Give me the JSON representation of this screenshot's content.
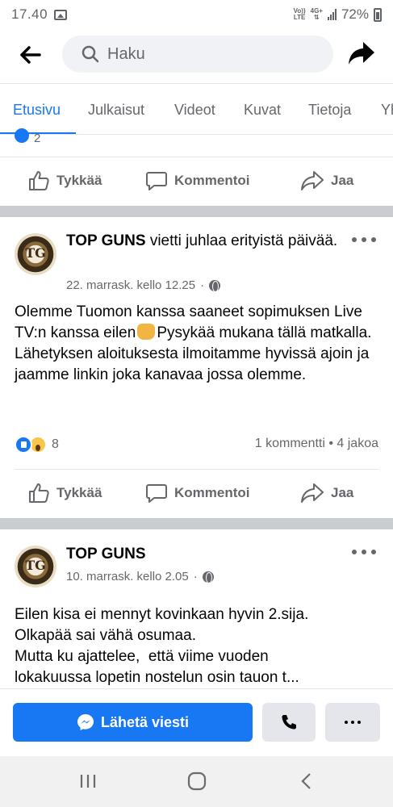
{
  "status_bar": {
    "time": "17.40",
    "network_top": "Vo))",
    "network_bottom": "LTE",
    "data_top": "4G+",
    "battery": "72%"
  },
  "header": {
    "search_placeholder": "Haku"
  },
  "tabs": [
    "Etusivu",
    "Julkaisut",
    "Videot",
    "Kuvat",
    "Tietoja",
    "Yh"
  ],
  "partial_post": {
    "reaction_count": "2"
  },
  "actions": {
    "like": "Tykkää",
    "comment": "Kommentoi",
    "share": "Jaa"
  },
  "posts": [
    {
      "author": "TOP GUNS",
      "title_rest": " vietti juhlaa erityistä päivää.",
      "date": "22. marrask. kello 12.25",
      "body_before_emoji": "Olemme Tuomon kanssa saaneet sopimuksen Live TV:n kanssa eilen",
      "body_after_emoji": "Pysykää mukana tällä matkalla. Lähetyksen aloituksesta ilmoitamme hyvissä ajoin ja jaamme linkin joka kanavaa jossa olemme.",
      "reaction_count": "8",
      "comments_shares": "1 kommentti • 4 jakoa"
    },
    {
      "author": "TOP GUNS",
      "date": "10. marrask. kello 2.05",
      "body_line1": "Eilen kisa ei mennyt kovinkaan hyvin 2.sija.",
      "body_line2": "Olkapää sai vähä osumaa.",
      "body_line3": "Mutta ku ajattelee,  että viime vuoden",
      "body_line4": "lokakuussa lopetin nostelun osin tauon t..."
    }
  ],
  "message_bar": {
    "send_label": "Lähetä viesti"
  },
  "colors": {
    "accent": "#1877f2",
    "muted_text": "#65676b",
    "separator": "#c9ccd1"
  }
}
